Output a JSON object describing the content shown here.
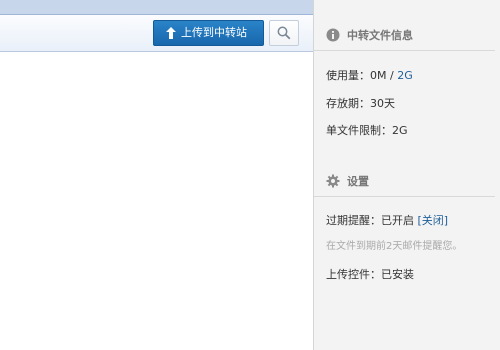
{
  "toolbar": {
    "upload_label": "上传到中转站",
    "upload_icon": "upload-arrow-icon",
    "search_icon": "search-icon"
  },
  "info": {
    "title": "中转文件信息",
    "usage_label": "使用量：",
    "usage_used": "0M",
    "usage_sep": " / ",
    "usage_total": "2G",
    "period_label": "存放期：",
    "period_value": "30天",
    "limit_label": "单文件限制：",
    "limit_value": "2G"
  },
  "settings": {
    "title": "设置",
    "expiry_label": "过期提醒：",
    "expiry_value": "已开启",
    "expiry_toggle": "[关闭]",
    "expiry_hint": "在文件到期前2天邮件提醒您。",
    "plugin_label": "上传控件：",
    "plugin_value": "已安装"
  },
  "colors": {
    "accent": "#1f6fb5",
    "link": "#1f5f99",
    "sidebar_bg": "#f3f3f3"
  }
}
